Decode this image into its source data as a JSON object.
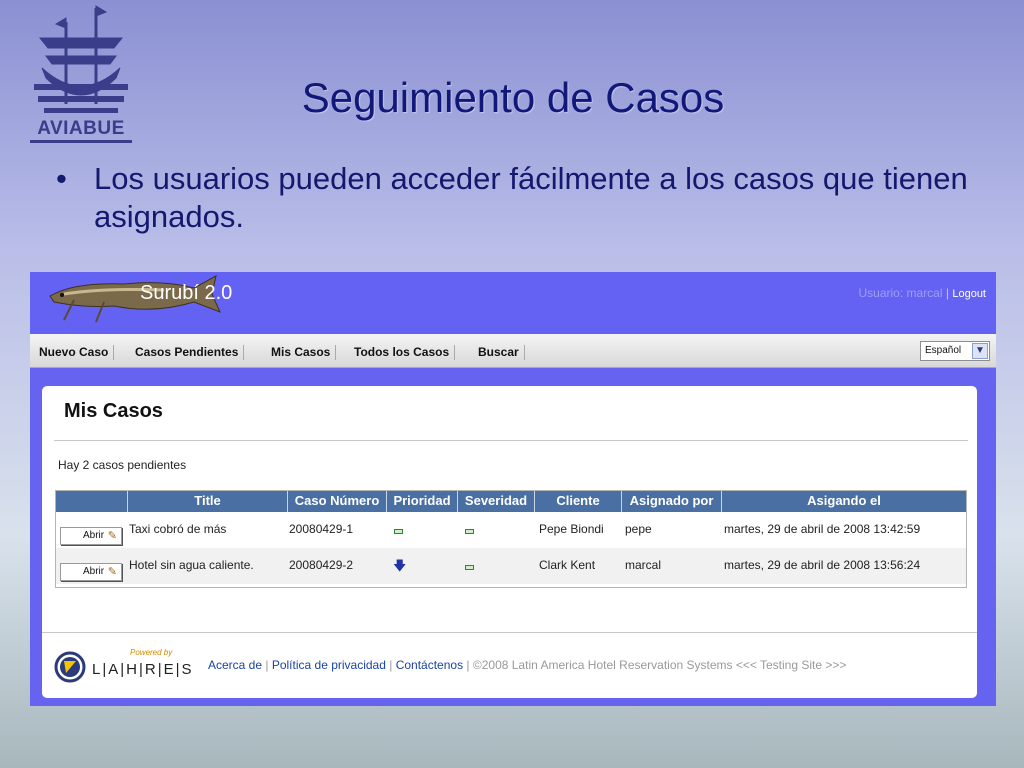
{
  "slide": {
    "logo_text": "AVIABUE",
    "title": "Seguimiento de Casos",
    "bullet_symbol": "•",
    "bullet_text": "Los usuarios pueden acceder fácilmente a los casos que tienen asignados."
  },
  "app": {
    "name": "Surubí 2.0",
    "user_label": "Usuario: marcal",
    "separator": "|",
    "logout_label": "Logout",
    "menu": [
      "Nuevo Caso",
      "Casos Pendientes",
      "Mis Casos",
      "Todos los Casos",
      "Buscar"
    ],
    "language": {
      "selected": "Español",
      "arrow_icon": "chevron-down-icon"
    },
    "page_heading": "Mis Casos",
    "pending_text": "Hay 2 casos pendientes",
    "table": {
      "columns": [
        "",
        "Title",
        "Caso Número",
        "Prioridad",
        "Severidad",
        "Cliente",
        "Asignado por",
        "Asigando el"
      ],
      "rows": [
        {
          "action": "Abrir",
          "title": "Taxi cobró de más",
          "case_number": "20080429-1",
          "priority_icon": "minus-icon",
          "severity_icon": "minus-icon",
          "client": "Pepe Biondi",
          "assigned_by": "pepe",
          "assigned_on": "martes, 29 de abril de 2008 13:42:59"
        },
        {
          "action": "Abrir",
          "title": "Hotel sin agua caliente.",
          "case_number": "20080429-2",
          "priority_icon": "arrow-down-icon",
          "severity_icon": "minus-icon",
          "client": "Clark Kent",
          "assigned_by": "marcal",
          "assigned_on": "martes, 29 de abril de 2008 13:56:24"
        }
      ]
    },
    "footer": {
      "powered_by": "Powered by",
      "brand": "L|A|H|R|E|S",
      "links": [
        "Acerca de",
        "Política de privacidad",
        "Contáctenos"
      ],
      "copyright": "©2008 Latin America Hotel Reservation Systems <<< Testing Site >>>"
    }
  },
  "colors": {
    "header": "#6462f2",
    "table_header": "#4a6fa3",
    "link": "#1b44a0",
    "title": "#12177a"
  }
}
